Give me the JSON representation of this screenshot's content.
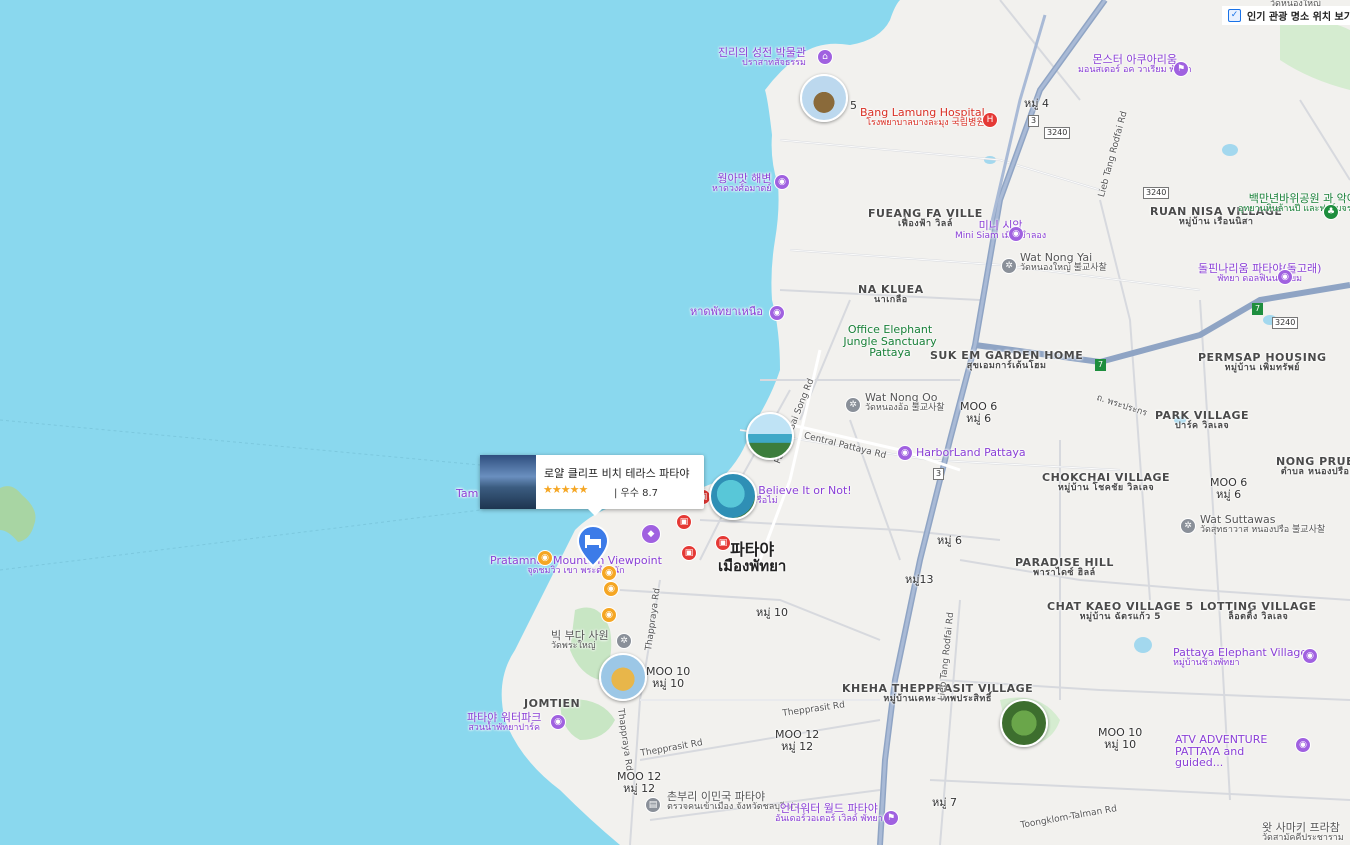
{
  "toggle": {
    "label": "인기 관광 명소 위치 보기",
    "checked": true
  },
  "hotel_card": {
    "name": "로얄 클리프 비치 테라스 파타야",
    "stars": "★★★★★",
    "rating": "| 우수 8.7"
  },
  "city": {
    "name_ko": "파타야",
    "name_th": "เมืองพัทยา"
  },
  "areas": [
    {
      "name": "FUEANG FA VILLE",
      "sub": "เฟื่องฟ้า วิลล์"
    },
    {
      "name": "NA KLUEA",
      "sub": "นาเกลือ"
    },
    {
      "name": "SUK EM GARDEN HOME",
      "sub": "สุขเอมการ์เด้นโฮม"
    },
    {
      "name": "RUAN NISA VILLAGE",
      "sub": "หมู่บ้าน เรือนนิสา"
    },
    {
      "name": "PERMSAP HOUSING",
      "sub": "หมู่บ้าน เพิ่มทรัพย์"
    },
    {
      "name": "PARK VILLAGE",
      "sub": "ปาร์ค วิลเลจ"
    },
    {
      "name": "CHOKCHAI VILLAGE",
      "sub": "หมู่บ้าน โชคชัย วิลเลจ"
    },
    {
      "name": "NONG PRUE",
      "sub": "ตำบล หนองปรือ"
    },
    {
      "name": "PARADISE HILL",
      "sub": "พาราไดซ์ ฮิลล์"
    },
    {
      "name": "CHAT KAEO VILLAGE 5",
      "sub": "หมู่บ้าน ฉัตรแก้ว 5"
    },
    {
      "name": "LOTTING VILLAGE",
      "sub": "ล็อตติ้ง วิลเลจ"
    },
    {
      "name": "KHEHA THEPPRASIT VILLAGE",
      "sub": "หมู่บ้านเคหะ เทพประสิทธิ์"
    },
    {
      "name": "JOMTIEN",
      "sub": ""
    }
  ],
  "moos": [
    {
      "name": "หมู่ 4",
      "sub": ""
    },
    {
      "name": "MOO 6",
      "sub": "หมู่ 6"
    },
    {
      "name": "MOO 6",
      "sub": "หมู่ 6"
    },
    {
      "name": "หมู่ 6",
      "sub": ""
    },
    {
      "name": "หมู่13",
      "sub": ""
    },
    {
      "name": "หมู่ 10",
      "sub": ""
    },
    {
      "name": "MOO 12",
      "sub": "หมู่ 12"
    },
    {
      "name": "MOO 12",
      "sub": "หมู่ 12"
    },
    {
      "name": "MOO 10",
      "sub": "หมู่ 10"
    },
    {
      "name": "หมู่ 7",
      "sub": ""
    },
    {
      "name": "MOO 10",
      "sub": "หมู่ 10"
    },
    {
      "name": "5",
      "sub": ""
    }
  ],
  "roads": {
    "lieb_tang_rodfai_north": "Lieb Tang Rodfai Rd",
    "lieb_tang_rodfai_south": "Lieb Tang Rodfai Rd",
    "central_pattaya": "Central Pattaya Rd",
    "pattaya_sai_song": "Pattaya Sai Song Rd",
    "thepprasit_1": "Thepprasit Rd",
    "thepprasit_2": "Thepprasit Rd",
    "thappraya_1": "Thappraya Rd",
    "thappraya_2": "Thappraya Rd",
    "toongklom": "Toongklom-Talman Rd",
    "pratamnak": "ถ. พระประกร"
  },
  "shields": [
    "3",
    "3240",
    "3240",
    "3240",
    "3",
    "7",
    "7"
  ],
  "pois": {
    "sanctuary": {
      "name": "진리의 성전 박물관",
      "sub": "ปราสาทสัจธรรม"
    },
    "monster": {
      "name": "몬스터 아쿠아리움",
      "sub": "มอนสเตอร์ อค วาเรียม พัทยา"
    },
    "bang_lamung": {
      "name": "Bang Lamung Hospital",
      "sub": "โรงพยาบาลบางละมุง 국립병원"
    },
    "wongamat": {
      "name": "웡아맛 해변",
      "sub": "หาดวงศ์อมาตย์"
    },
    "mini_siam": {
      "name": "미니 시암",
      "sub": "Mini Siam เมืองจำลอง"
    },
    "wat_nong_yai": {
      "name": "Wat Nong Yai",
      "sub": "วัดหนองใหญ่ 불교사찰"
    },
    "dolphin": {
      "name": "돌핀나리움 파타야(돌고래)",
      "sub": "พัทยา ดอลฟินนาเรียม"
    },
    "centennial": {
      "name": "백만년바위공원 과 악어농장",
      "sub": "อุทยานหินล้านปี และฟาร์มจระเข้พัทยา"
    },
    "north_beach": {
      "name": "หาดพัทยาเหนือ",
      "sub": ""
    },
    "elephant_jungle": {
      "name": "Office Elephant Jungle Sanctuary Pattaya",
      "sub": ""
    },
    "wat_nong_oo": {
      "name": "Wat Nong Oo",
      "sub": "วัดหนองอ้อ 불교사찰"
    },
    "harborland": {
      "name": "HarborLand Pattaya",
      "sub": ""
    },
    "ripleys": {
      "name": "Ripley's Believe It or Not!",
      "sub": "ริปลีส์ เชื่อหรือไม่"
    },
    "tamnak_view": {
      "name": "Pratamnak Mountain Viewpoint",
      "sub": "จุดชมวิว เขา พระตำหนัก"
    },
    "big_buddha": {
      "name": "빅 부다 사원",
      "sub": "วัดพระใหญ่"
    },
    "wat_suttawas": {
      "name": "Wat Suttawas",
      "sub": "วัดสุทธาวาส หนองปรือ 불교사찰"
    },
    "elephant_village": {
      "name": "Pattaya Elephant Village",
      "sub": "หมู่บ้านช้างพัทยา"
    },
    "water_park": {
      "name": "파타야 워터파크",
      "sub": "สวนน้ำพัทยาปาร์ค"
    },
    "atv": {
      "name": "ATV ADVENTURE PATTAYA and guided...",
      "sub": ""
    },
    "chonburi": {
      "name": "촌부리 이민국 파타야",
      "sub": "ตรวจคนเข้าเมือง จังหวัดชลบุรี ท่า..."
    },
    "underwater": {
      "name": "언더워터 월드 파타야",
      "sub": "อันเดอร์วอเตอร์ เวิลด์ พัทยา"
    },
    "wat_samakki": {
      "name": "왓 사마키 프라참",
      "sub": "วัดสามัคคีประชาราม"
    },
    "top_road": {
      "name": "วัดหนองใหญ่",
      "sub": ""
    },
    "tamnak": {
      "name": "Tam",
      "sub": ""
    }
  }
}
